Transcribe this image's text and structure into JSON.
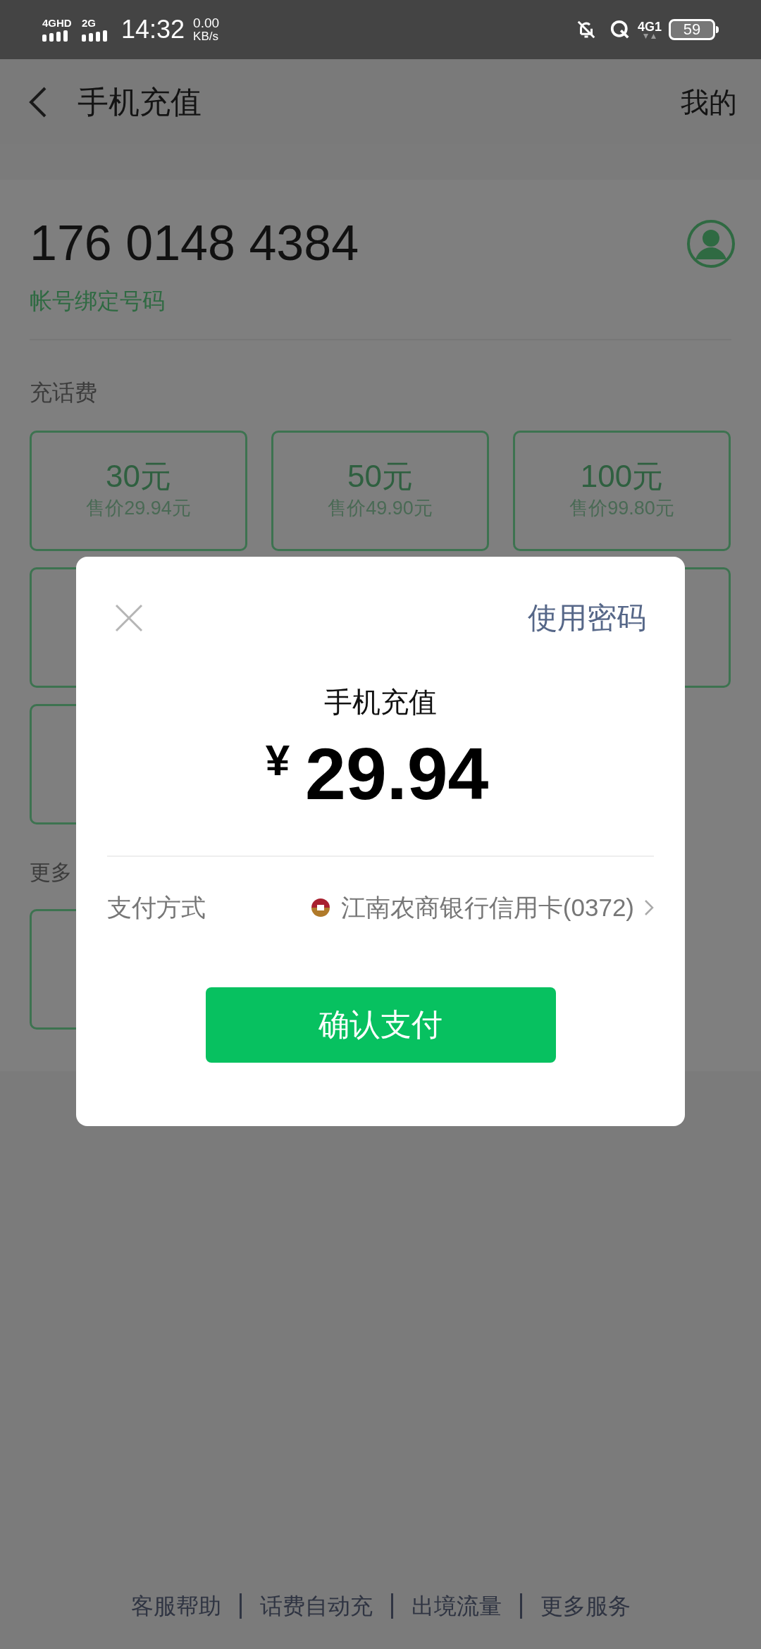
{
  "status_bar": {
    "network_1": "4GHD",
    "network_2": "2G",
    "time": "14:32",
    "speed_value": "0.00",
    "speed_unit": "KB/s",
    "network_3": "4G1",
    "battery": "59"
  },
  "header": {
    "title": "手机充值",
    "action": "我的"
  },
  "account": {
    "phone": "176 0148 4384",
    "note": "帐号绑定号码"
  },
  "section_title": "充话费",
  "options": [
    {
      "amount": "30元",
      "price": "售价29.94元"
    },
    {
      "amount": "50元",
      "price": "售价49.90元"
    },
    {
      "amount": "100元",
      "price": "售价99.80元"
    }
  ],
  "more_title": "更多",
  "footer_links": [
    "客服帮助",
    "话费自动充",
    "出境流量",
    "更多服务"
  ],
  "dialog": {
    "password_link": "使用密码",
    "title": "手机充值",
    "currency": "¥",
    "amount": "29.94",
    "payment_label": "支付方式",
    "payment_method": "江南农商银行信用卡(0372)",
    "confirm": "确认支付"
  }
}
